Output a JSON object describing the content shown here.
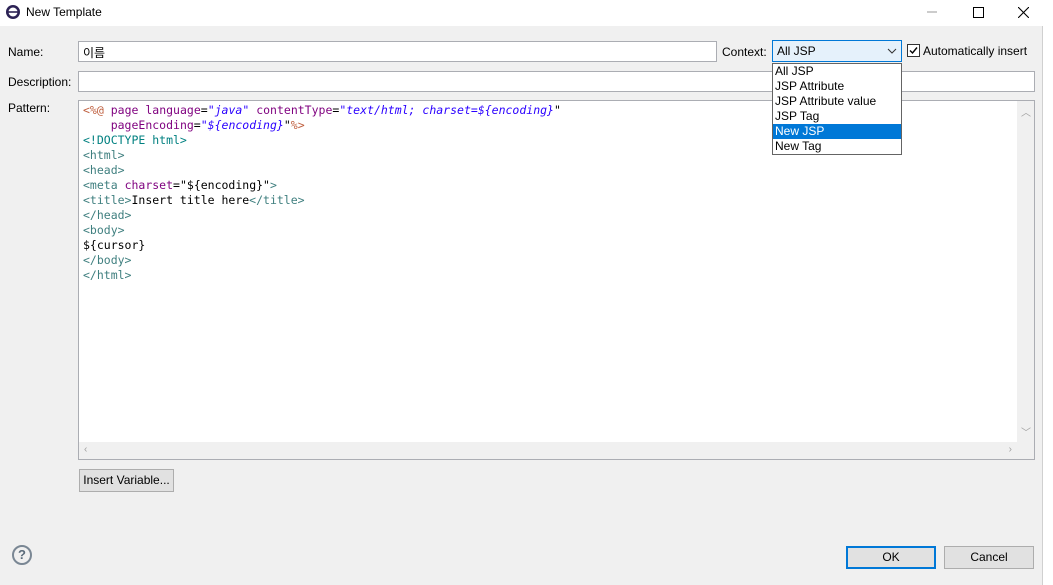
{
  "window": {
    "title": "New Template"
  },
  "form": {
    "name_label": "Name:",
    "name_value": "이름",
    "context_label": "Context:",
    "context_value": "All JSP",
    "context_options": [
      "All JSP",
      "JSP Attribute",
      "JSP Attribute value",
      "JSP Tag",
      "New JSP",
      "New Tag"
    ],
    "context_selected_index": 4,
    "auto_insert_label": "Automatically insert",
    "auto_insert_checked": true,
    "description_label": "Description:",
    "description_value": "",
    "pattern_label": "Pattern:"
  },
  "pattern": {
    "line1": {
      "delim_open": "<%@",
      "page": "page",
      "lang_attr": "language",
      "eq": "=",
      "q": "\"",
      "lang_val": "java",
      "ct_attr": "contentType",
      "ct_val": "text/html; charset=",
      "enc_var": "${encoding}"
    },
    "line2": {
      "pe_attr": "pageEncoding",
      "enc_var": "${encoding}",
      "delim_close": "%>"
    },
    "doctype": "<!DOCTYPE html>",
    "html_open": "<html>",
    "head_open": "<head>",
    "meta_open": "<meta",
    "meta_attr": "charset",
    "meta_val": "\"${encoding}\"",
    "meta_close": ">",
    "title_open": "<title>",
    "title_text": "Insert title here",
    "title_close": "</title>",
    "head_close": "</head>",
    "body_open": "<body>",
    "cursor": "${cursor}",
    "body_close": "</body>",
    "html_close": "</html>"
  },
  "buttons": {
    "insert_variable": "Insert Variable...",
    "ok": "OK",
    "cancel": "Cancel"
  },
  "icons": {
    "app": "eclipse-icon",
    "minimize": "minimize-icon",
    "maximize": "maximize-icon",
    "close": "close-icon",
    "help": "help-icon",
    "dropdown": "chevron-down-icon",
    "checkbox": "checkmark-icon"
  }
}
